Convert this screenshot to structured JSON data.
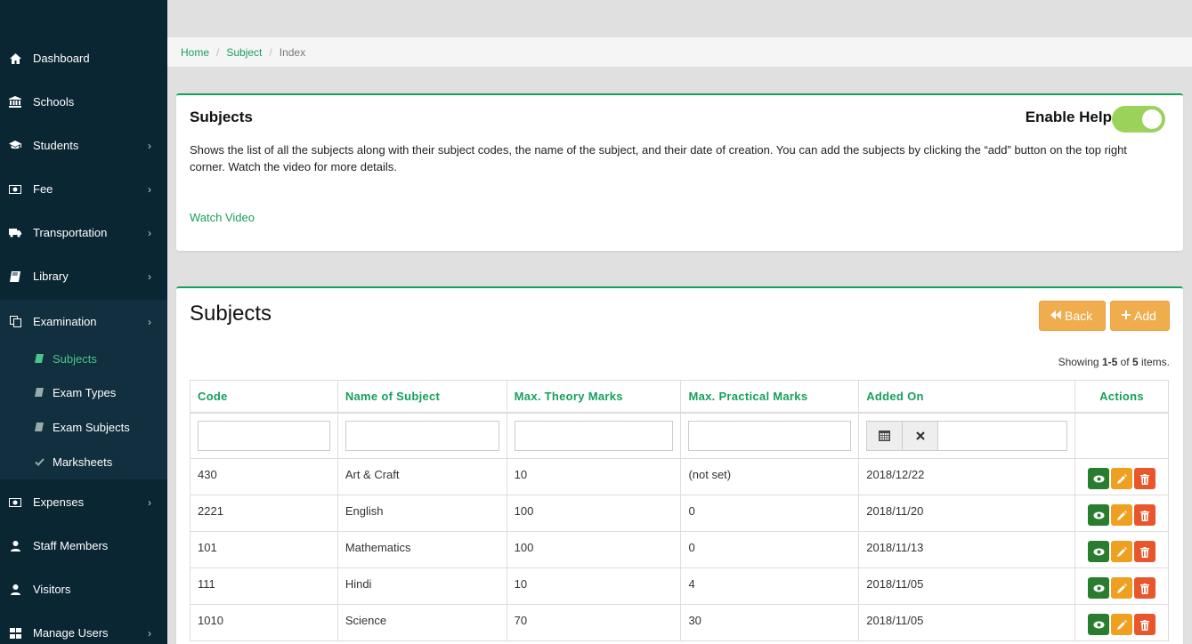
{
  "sidebar": {
    "items": [
      {
        "label": "Dashboard",
        "icon": "home-icon"
      },
      {
        "label": "Schools",
        "icon": "bank-icon"
      },
      {
        "label": "Students",
        "icon": "graduation-cap-icon"
      },
      {
        "label": "Fee",
        "icon": "money-icon"
      },
      {
        "label": "Transportation",
        "icon": "truck-icon"
      },
      {
        "label": "Library",
        "icon": "book-icon"
      },
      {
        "label": "Examination",
        "icon": "copy-icon"
      },
      {
        "label": "Expenses",
        "icon": "money-icon"
      },
      {
        "label": "Staff Members",
        "icon": "user-icon"
      },
      {
        "label": "Visitors",
        "icon": "user-icon"
      },
      {
        "label": "Manage Users",
        "icon": "grid-icon"
      }
    ],
    "examination_sub": [
      {
        "label": "Subjects",
        "icon": "book-icon"
      },
      {
        "label": "Exam Types",
        "icon": "book-icon"
      },
      {
        "label": "Exam Subjects",
        "icon": "book-icon"
      },
      {
        "label": "Marksheets",
        "icon": "check-icon"
      }
    ]
  },
  "breadcrumb": {
    "home": "Home",
    "subject": "Subject",
    "current": "Index"
  },
  "help": {
    "title": "Subjects",
    "toggle_label": "Enable Help",
    "text": "Shows the list of all the subjects along with their subject codes, the name of the subject, and their date of creation. You can add the subjects by clicking the “add” button on the top right corner. Watch the video for more details.",
    "watch_link": "Watch Video"
  },
  "list": {
    "title": "Subjects",
    "back_label": "Back",
    "add_label": "Add",
    "summary_prefix": "Showing ",
    "summary_range": "1-5",
    "summary_of": " of ",
    "summary_total": "5",
    "summary_suffix": " items.",
    "columns": [
      "Code",
      "Name of Subject",
      "Max. Theory Marks",
      "Max. Practical Marks",
      "Added On",
      "Actions"
    ],
    "rows": [
      {
        "code": "430",
        "name": "Art & Craft",
        "theory": "10",
        "practical": "(not set)",
        "added": "2018/12/22"
      },
      {
        "code": "2221",
        "name": "English",
        "theory": "100",
        "practical": "0",
        "added": "2018/11/20"
      },
      {
        "code": "101",
        "name": "Mathematics",
        "theory": "100",
        "practical": "0",
        "added": "2018/11/13"
      },
      {
        "code": "111",
        "name": "Hindi",
        "theory": "10",
        "practical": "4",
        "added": "2018/11/05"
      },
      {
        "code": "1010",
        "name": "Science",
        "theory": "70",
        "practical": "30",
        "added": "2018/11/05"
      }
    ]
  },
  "colors": {
    "accent": "#17a05d",
    "sidebar": "#0b2633",
    "warning": "#f0ad4e",
    "view": "#2a7d2e",
    "edit": "#f0a020",
    "delete": "#e8572c",
    "toggle": "#9bd35a"
  }
}
